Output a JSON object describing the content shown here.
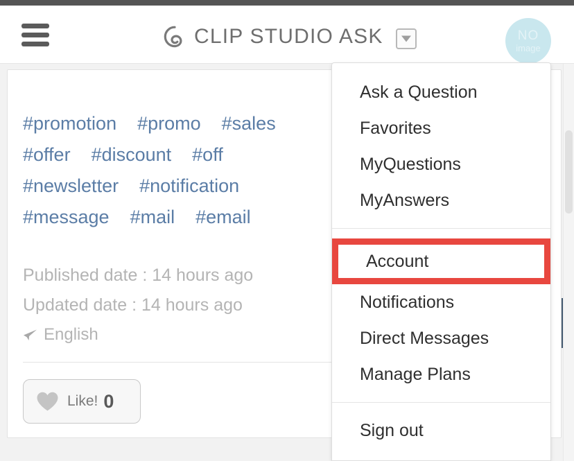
{
  "header": {
    "menu_icon": "hamburger-icon",
    "logo_icon": "clip-studio-spiral-logo",
    "title": "CLIP STUDIO ASK",
    "dropdown_icon": "caret-down-icon",
    "avatar": {
      "line1": "NO",
      "line2": "image"
    }
  },
  "content": {
    "tag_rows": [
      [
        "#promotion",
        "#promo",
        "#sales"
      ],
      [
        "#offer",
        "#discount",
        "#off"
      ],
      [
        "#newsletter",
        "#notification"
      ],
      [
        "#message",
        "#mail",
        "#email"
      ]
    ],
    "published_date": "Published date : 14 hours ago",
    "updated_date": "Updated date : 14 hours ago",
    "language_icon": "paper-plane-icon",
    "language": "English",
    "like": {
      "icon": "heart-icon",
      "label": "Like!",
      "count": "0"
    }
  },
  "menu": {
    "group1": [
      "Ask a Question",
      "Favorites",
      "MyQuestions",
      "MyAnswers"
    ],
    "highlighted": "Account",
    "group2": [
      "Notifications",
      "Direct Messages",
      "Manage Plans"
    ],
    "group3": [
      "Sign out"
    ]
  },
  "colors": {
    "highlight": "#e8473f",
    "tag_link": "#5b7da6",
    "avatar_bg": "#c9e7ee",
    "header_text": "#6e6e6e",
    "muted_text": "#b4b4b4"
  }
}
